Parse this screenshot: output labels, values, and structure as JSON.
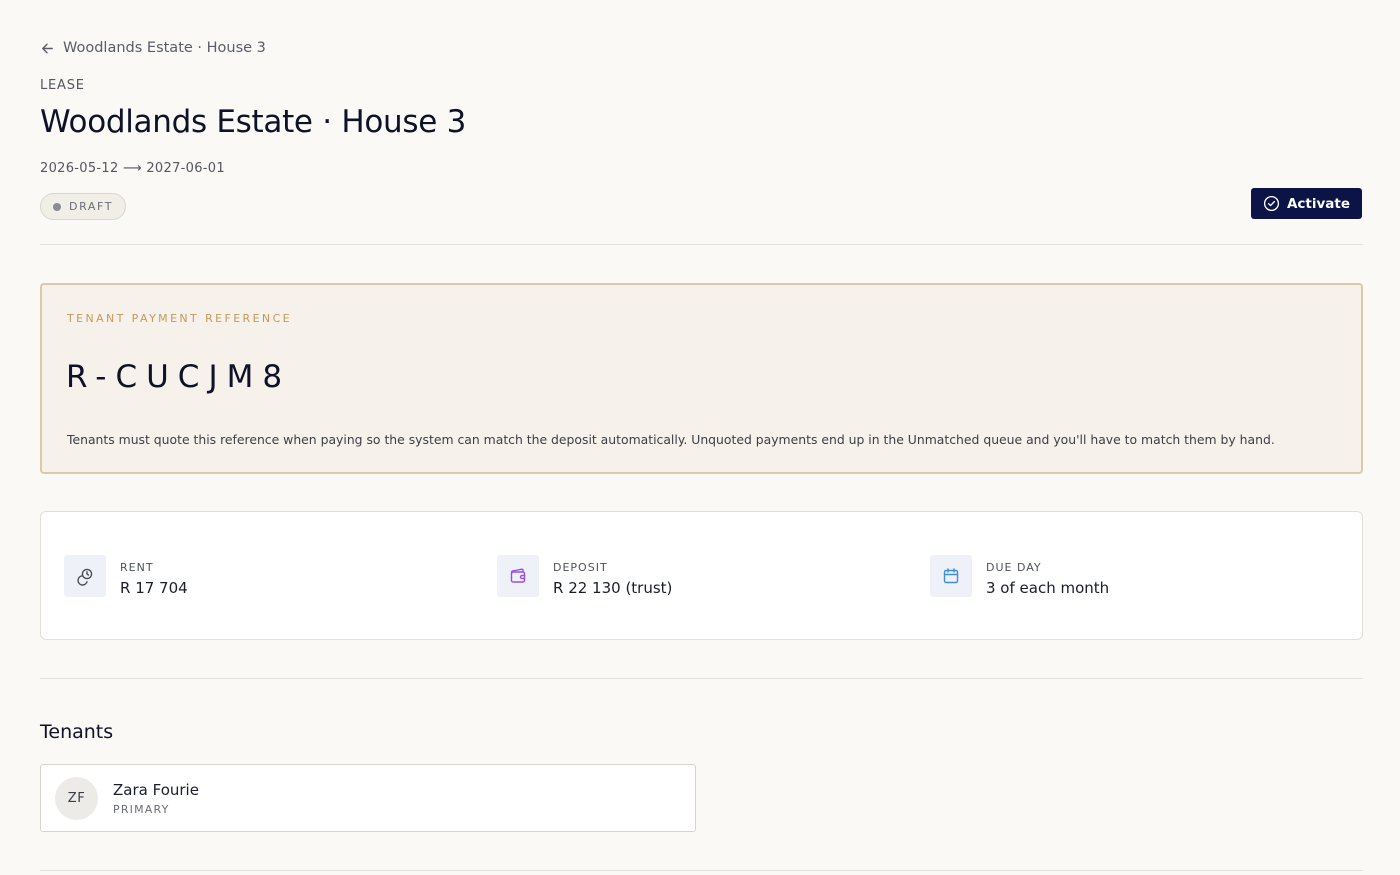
{
  "breadcrumb": {
    "back_label": "Woodlands Estate · House 3"
  },
  "header": {
    "eyebrow": "LEASE",
    "title": "Woodlands Estate · House 3",
    "date_range": "2026-05-12 ⟶ 2027-06-01",
    "status": "DRAFT",
    "activate_label": "Activate"
  },
  "reference": {
    "label": "TENANT PAYMENT REFERENCE",
    "code": "R-CUCJM8",
    "note": "Tenants must quote this reference when paying so the system can match the deposit automatically. Unquoted payments end up in the Unmatched queue and you'll have to match them by hand."
  },
  "terms": {
    "rent": {
      "label": "RENT",
      "value": "R 17 704",
      "icon": "coins-icon"
    },
    "deposit": {
      "label": "DEPOSIT",
      "value": "R 22 130 (trust)",
      "icon": "wallet-icon"
    },
    "due_day": {
      "label": "DUE DAY",
      "value": "3 of each month",
      "icon": "calendar-icon"
    }
  },
  "tenants": {
    "title": "Tenants",
    "items": [
      {
        "initials": "ZF",
        "name": "Zara Fourie",
        "role": "PRIMARY"
      }
    ]
  },
  "colors": {
    "accent": "#0c1447",
    "reference_bg": "#f6f1ea",
    "reference_border": "#dcc9ab",
    "reference_label": "#c39a5e",
    "deposit_icon": "#9b4fe0",
    "calendar_icon": "#3f8fd6"
  }
}
